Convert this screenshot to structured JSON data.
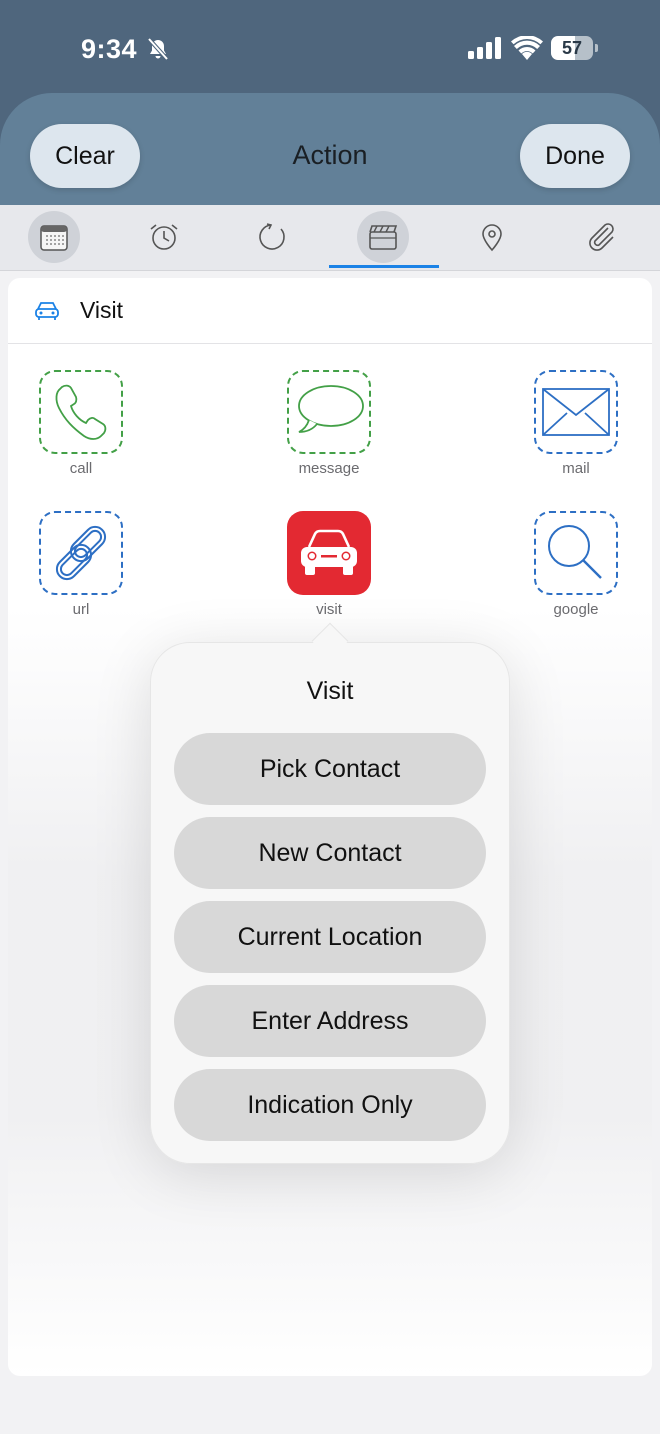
{
  "status": {
    "time": "9:34",
    "battery": "57",
    "battery_level": 0.57,
    "icons": [
      "bell-slash-icon",
      "cellular-signal-icon",
      "wifi-icon",
      "battery-icon"
    ]
  },
  "nav": {
    "clear_label": "Clear",
    "title": "Action",
    "done_label": "Done"
  },
  "tabs": [
    {
      "icon": "calendar-icon",
      "selected": true
    },
    {
      "icon": "alarm-clock-icon",
      "selected": false
    },
    {
      "icon": "repeat-icon",
      "selected": false
    },
    {
      "icon": "clapperboard-icon",
      "selected": true,
      "active": true
    },
    {
      "icon": "location-pin-icon",
      "selected": false
    },
    {
      "icon": "paperclip-icon",
      "selected": false
    }
  ],
  "card": {
    "header_icon": "car-icon",
    "header_title": "Visit",
    "actions": [
      {
        "label": "call",
        "icon": "phone-icon",
        "style": "dashed-green"
      },
      {
        "label": "message",
        "icon": "speech-bubble-icon",
        "style": "dashed-green"
      },
      {
        "label": "mail",
        "icon": "envelope-icon",
        "style": "dashed-blue"
      },
      {
        "label": "url",
        "icon": "link-icon",
        "style": "dashed-blue"
      },
      {
        "label": "visit",
        "icon": "car-icon",
        "style": "filled-red"
      },
      {
        "label": "google",
        "icon": "magnifier-icon",
        "style": "dashed-blue"
      }
    ]
  },
  "popover": {
    "title": "Visit",
    "options": [
      "Pick Contact",
      "New Contact",
      "Current Location",
      "Enter Address",
      "Indication Only"
    ]
  },
  "colors": {
    "header": "#4f667d",
    "sheet": "#628098",
    "accent": "#1b82e6",
    "green": "#43a047",
    "blue": "#2d6fc4",
    "red": "#e32932"
  }
}
